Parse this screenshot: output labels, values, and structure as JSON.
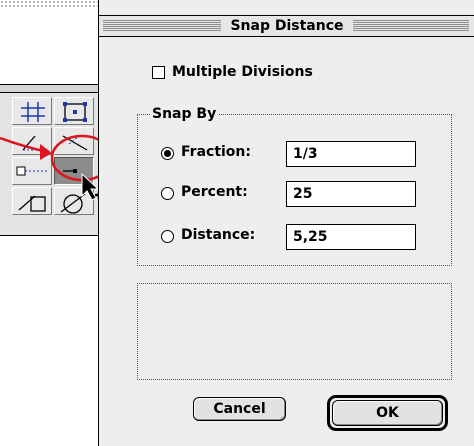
{
  "dialog": {
    "title": "Snap Distance",
    "multiple_divisions_label": "Multiple Divisions",
    "multiple_divisions_checked": false,
    "snap_by": {
      "group_label": "Snap By",
      "options": [
        {
          "label": "Fraction:",
          "value": "1/3",
          "selected": true
        },
        {
          "label": "Percent:",
          "value": "25",
          "selected": false
        },
        {
          "label": "Distance:",
          "value": "5,25",
          "selected": false
        }
      ]
    },
    "cancel_label": "Cancel",
    "ok_label": "OK"
  },
  "palette": {
    "tools": [
      "snap-grid-icon",
      "snap-points-icon",
      "snap-angle-icon",
      "snap-line-icon",
      "snap-perpendicular-icon",
      "snap-distance-icon",
      "snap-tangent-icon",
      "snap-circle-icon"
    ],
    "selected_tool": "snap-distance-icon"
  },
  "annotation": {
    "color": "#e0141e"
  }
}
